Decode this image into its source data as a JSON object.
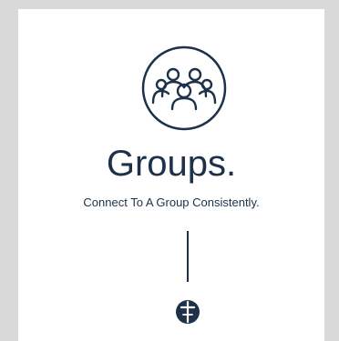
{
  "section": {
    "title": "Groups.",
    "subtitle": "Connect To A Group Consistently."
  },
  "icons": {
    "groups": "groups-icon",
    "logo": "church-logo-icon"
  },
  "colors": {
    "background": "#d9d9d9",
    "card": "#ffffff",
    "primary": "#1d3149"
  }
}
